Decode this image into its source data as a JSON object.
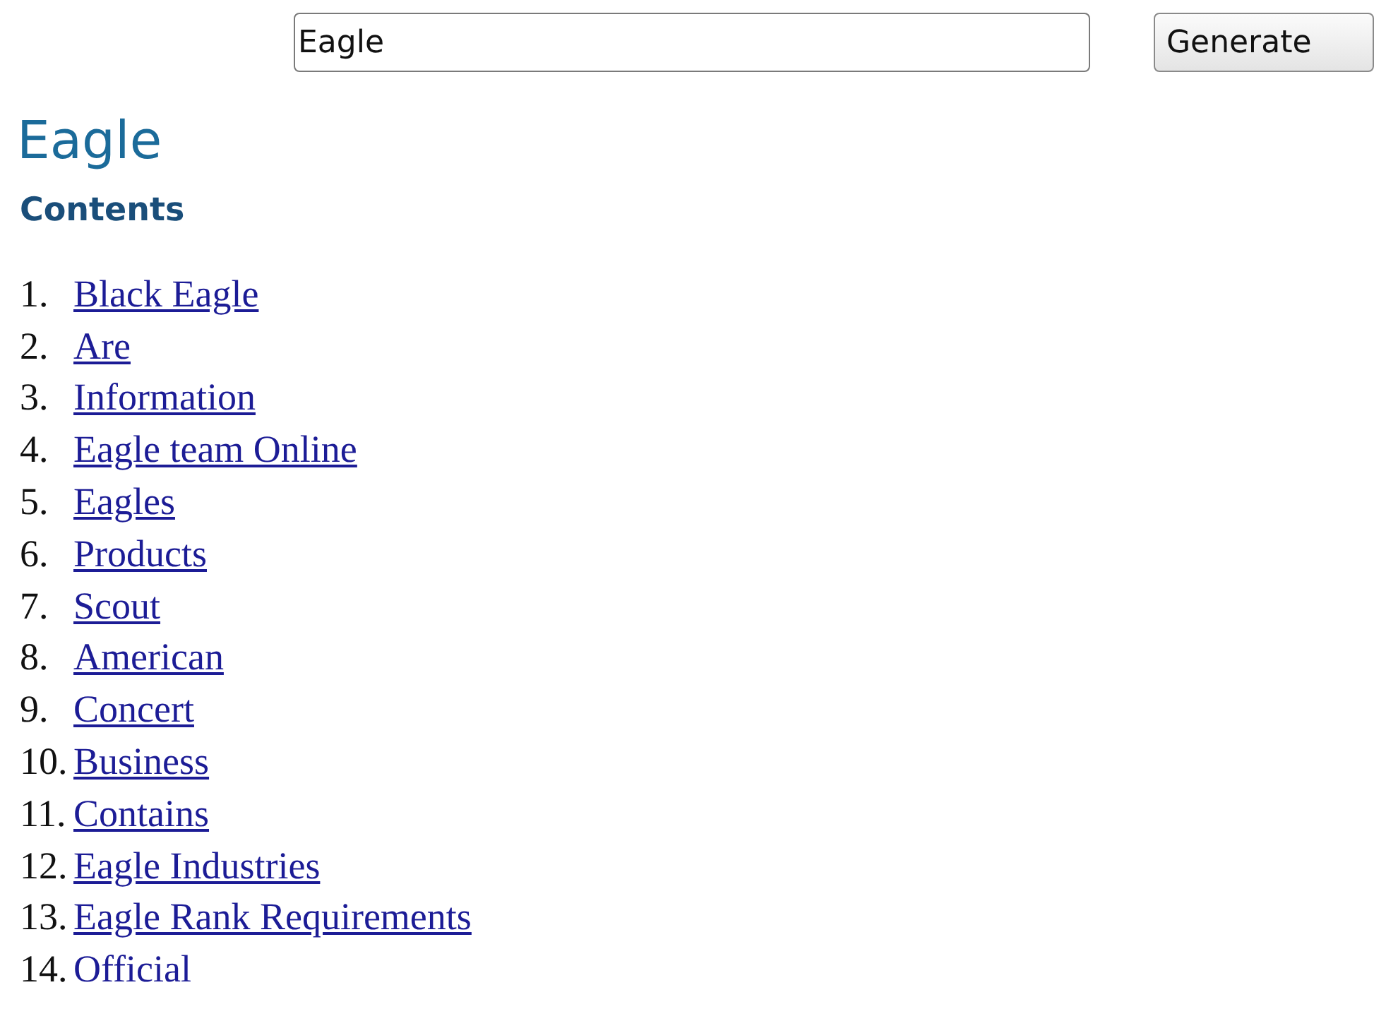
{
  "search": {
    "value": "Eagle"
  },
  "generate_button": "Generate",
  "title": "Eagle",
  "contents_heading": "Contents",
  "contents": [
    {
      "number": "1.",
      "label": "Black Eagle",
      "underlined": true
    },
    {
      "number": "2.",
      "label": "Are",
      "underlined": true
    },
    {
      "number": "3.",
      "label": "Information",
      "underlined": true
    },
    {
      "number": "4.",
      "label": "Eagle team Online",
      "underlined": true
    },
    {
      "number": "5.",
      "label": "Eagles",
      "underlined": true
    },
    {
      "number": "6.",
      "label": "Products",
      "underlined": true
    },
    {
      "number": "7.",
      "label": "Scout",
      "underlined": true
    },
    {
      "number": "8.",
      "label": "American",
      "underlined": true
    },
    {
      "number": "9.",
      "label": "Concert",
      "underlined": true
    },
    {
      "number": "10.",
      "label": "Business",
      "underlined": true
    },
    {
      "number": "11.",
      "label": "Contains",
      "underlined": true
    },
    {
      "number": "12.",
      "label": "Eagle Industries",
      "underlined": true
    },
    {
      "number": "13.",
      "label": "Eagle Rank Requirements",
      "underlined": true
    },
    {
      "number": "14.",
      "label": "Official",
      "underlined": false
    }
  ]
}
